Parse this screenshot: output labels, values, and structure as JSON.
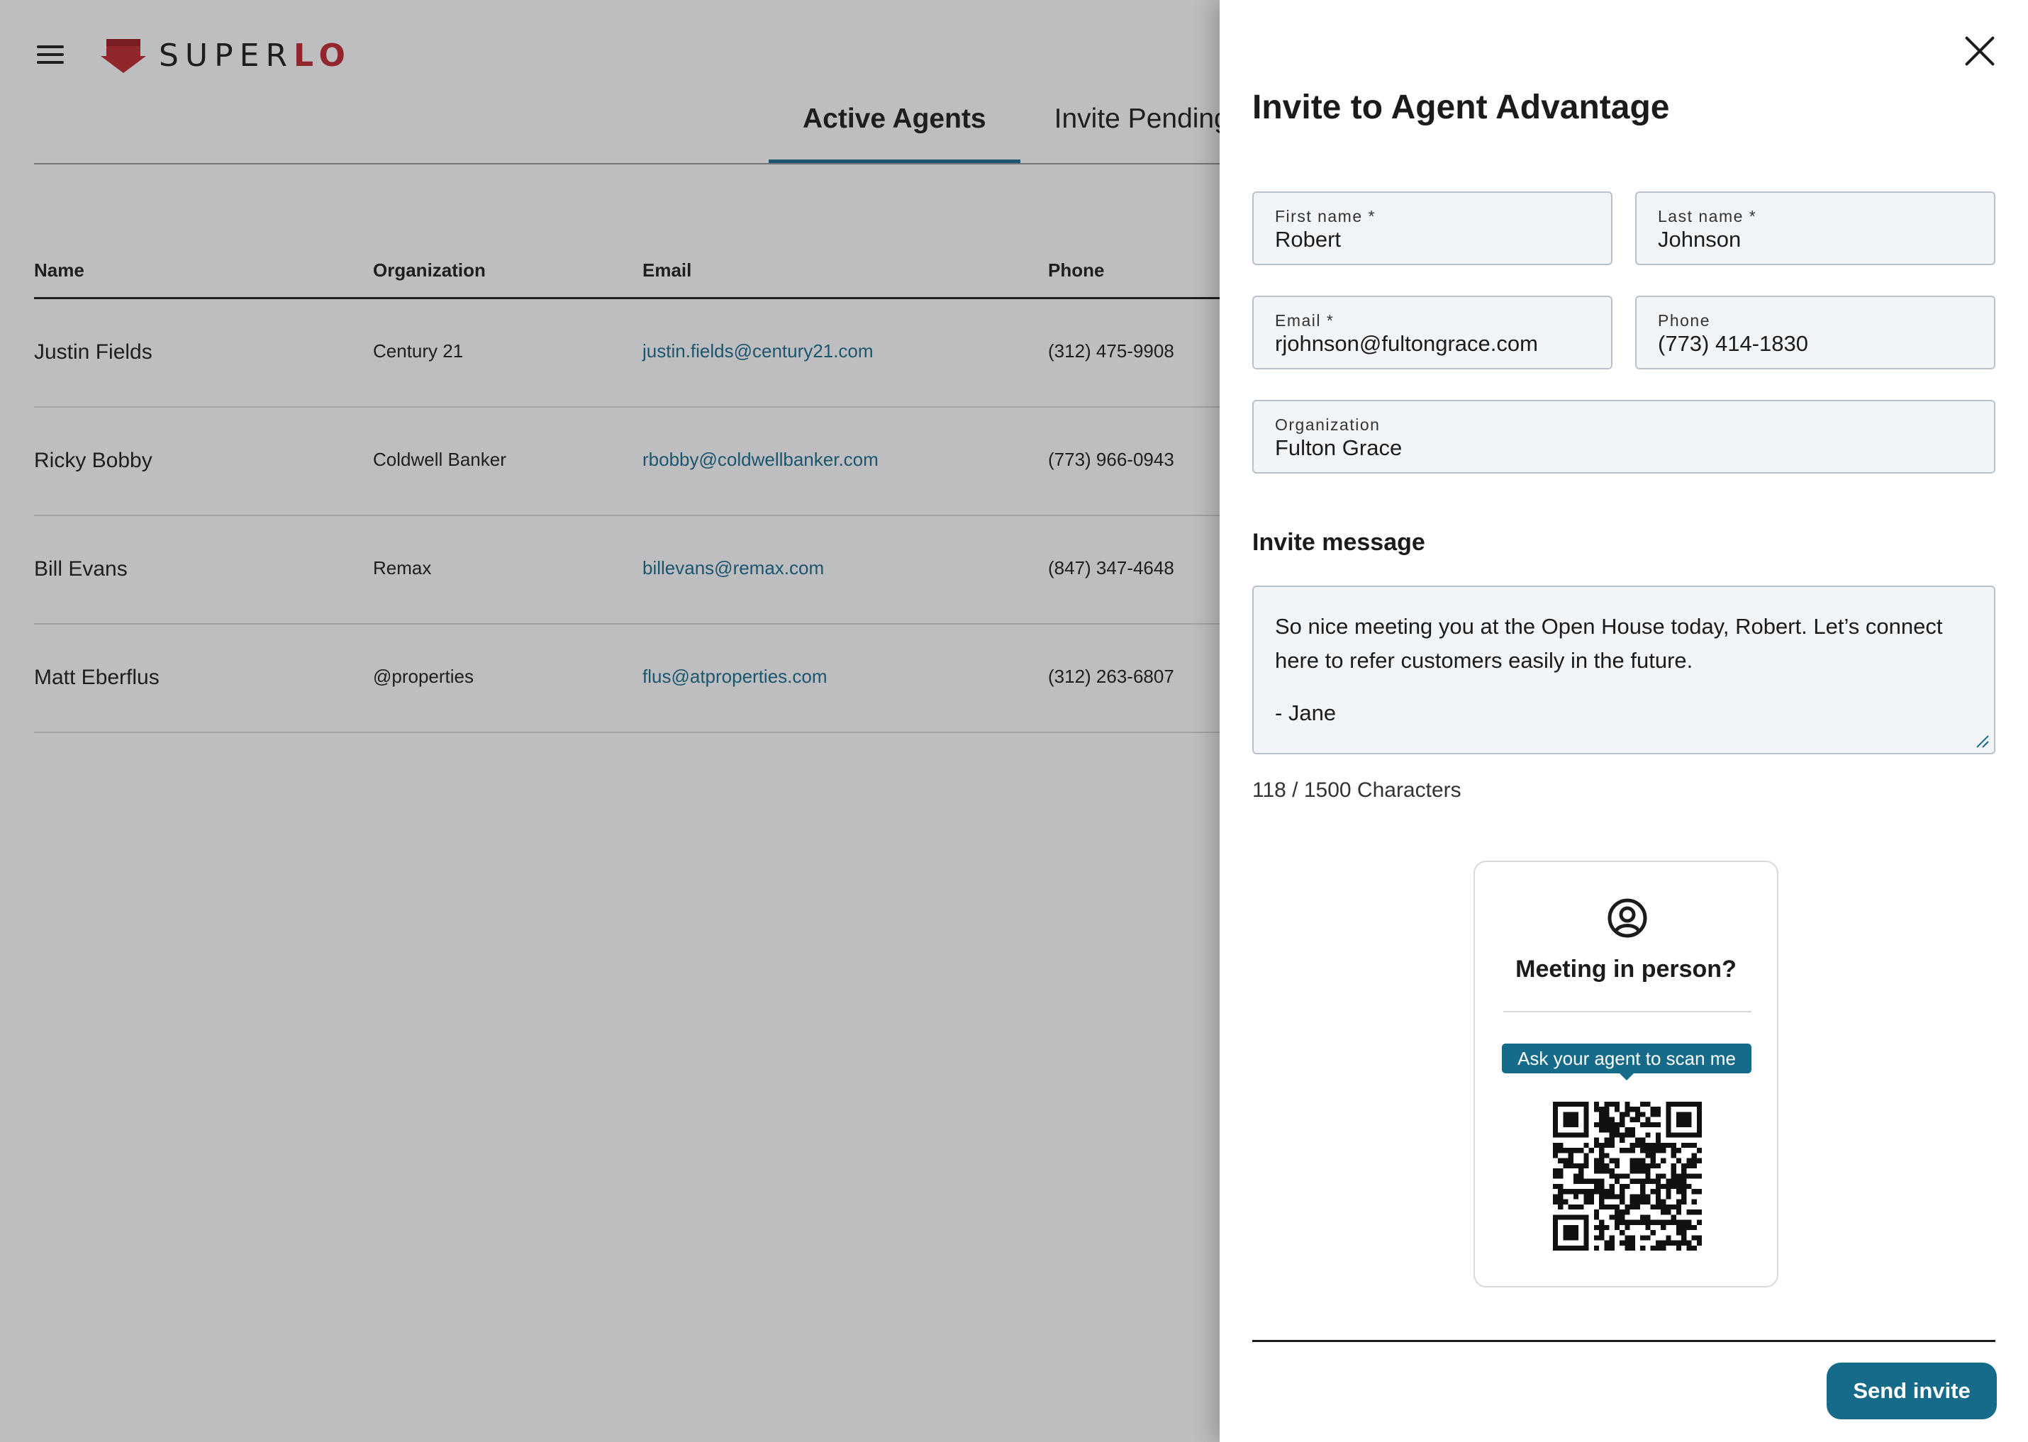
{
  "brand": {
    "name_part1": "SUPER",
    "name_part2": "LO",
    "accent_color": "#c0262d"
  },
  "tabs": [
    {
      "label": "Active Agents",
      "active": true
    },
    {
      "label": "Invite Pending",
      "active": false
    }
  ],
  "table": {
    "columns": [
      "Name",
      "Organization",
      "Email",
      "Phone"
    ],
    "rows": [
      {
        "name": "Justin Fields",
        "organization": "Century 21",
        "email": "justin.fields@century21.com",
        "phone": "(312) 475-9908"
      },
      {
        "name": "Ricky Bobby",
        "organization": "Coldwell Banker",
        "email": "rbobby@coldwellbanker.com",
        "phone": "(773) 966-0943"
      },
      {
        "name": "Bill Evans",
        "organization": "Remax",
        "email": "billevans@remax.com",
        "phone": "(847) 347-4648"
      },
      {
        "name": "Matt Eberflus",
        "organization": "@properties",
        "email": "flus@atproperties.com",
        "phone": "(312) 263-6807"
      }
    ]
  },
  "drawer": {
    "title": "Invite to Agent Advantage",
    "fields": {
      "first_name": {
        "label": "First name *",
        "value": "Robert"
      },
      "last_name": {
        "label": "Last name *",
        "value": "Johnson"
      },
      "email": {
        "label": "Email *",
        "value": "rjohnson@fultongrace.com"
      },
      "phone": {
        "label": "Phone",
        "value": "(773) 414-1830"
      },
      "organization": {
        "label": "Organization",
        "value": "Fulton Grace"
      }
    },
    "message_heading": "Invite message",
    "message_line1": "So nice meeting you at the Open House today, Robert. Let’s connect here to refer customers easily in the future.",
    "message_line2": "- Jane",
    "char_count": "118 / 1500 Characters",
    "card": {
      "title": "Meeting in person?",
      "badge": "Ask your agent to scan me",
      "icon": "user-circle-icon"
    },
    "send_label": "Send invite",
    "accent_color": "#176b8a"
  }
}
